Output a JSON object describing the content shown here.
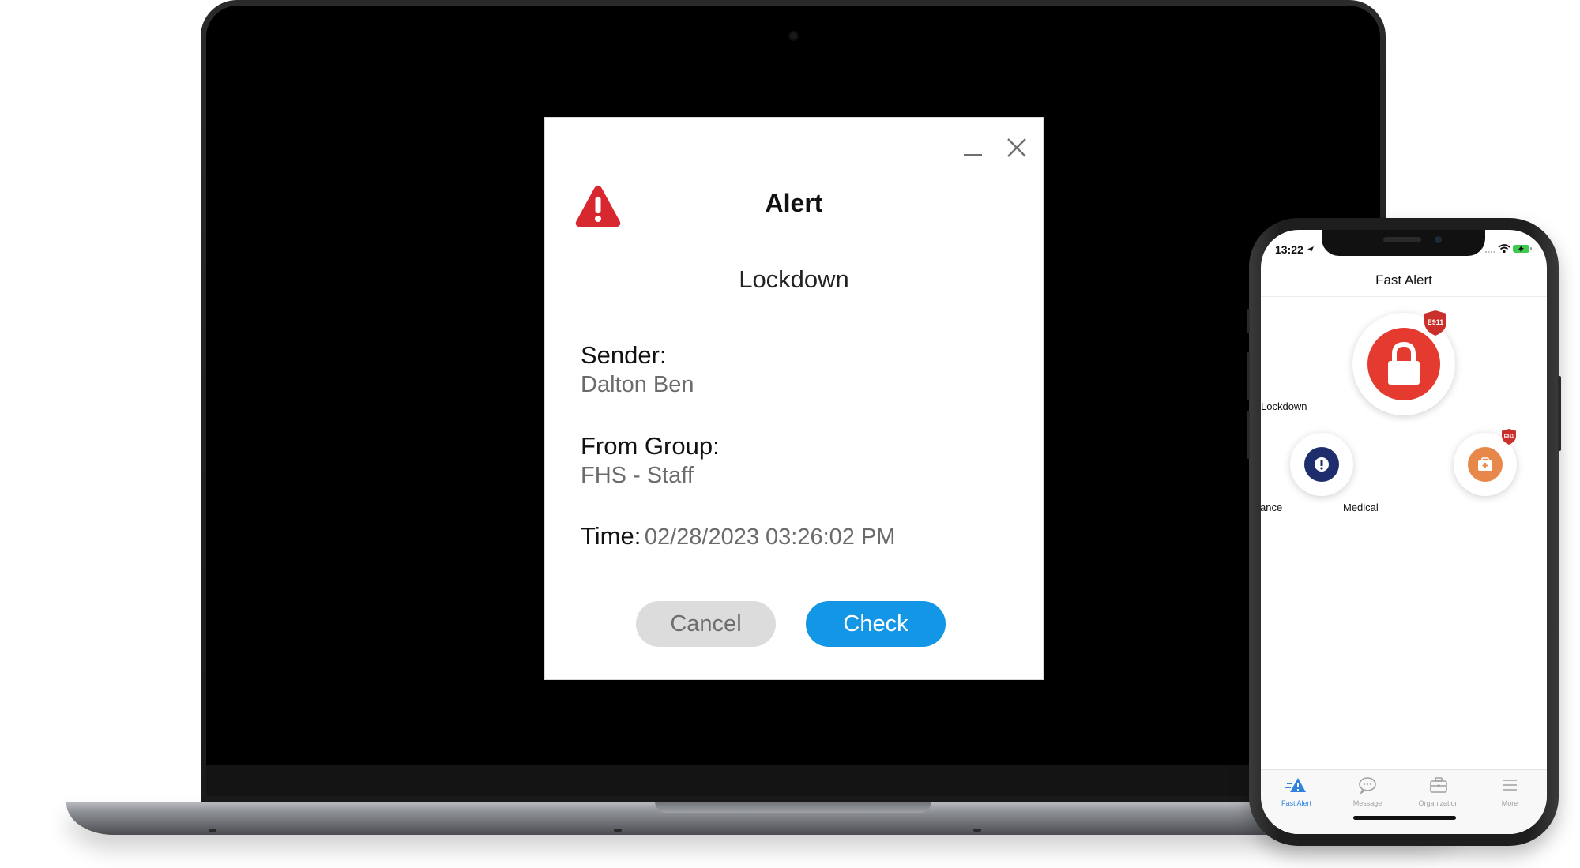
{
  "dialog": {
    "title": "Alert",
    "alert_type": "Lockdown",
    "sender_label": "Sender:",
    "sender_value": "Dalton Ben",
    "group_label": "From Group:",
    "group_value": "FHS - Staff",
    "time_label": "Time:",
    "time_value": "02/28/2023 03:26:02 PM",
    "cancel_label": "Cancel",
    "check_label": "Check",
    "icons": [
      "warning-triangle-icon",
      "minimize-icon",
      "close-icon"
    ]
  },
  "phone": {
    "status_time": "13:22",
    "app_title": "Fast Alert",
    "actions": [
      {
        "label": "Lockdown",
        "icon": "lock-icon",
        "color": "#e53a2f",
        "badge": "E911"
      },
      {
        "label": "Staff Assistance",
        "icon": "exclamation-icon",
        "color": "#1e2d6b"
      },
      {
        "label": "Medical",
        "icon": "first-aid-icon",
        "color": "#e8874a",
        "badge": "E911"
      }
    ],
    "tabs": [
      {
        "label": "Fast Alert",
        "active": true
      },
      {
        "label": "Message",
        "active": false
      },
      {
        "label": "Organization",
        "active": false
      },
      {
        "label": "More",
        "active": false
      }
    ]
  },
  "colors": {
    "alert_red": "#d7282f",
    "check_blue": "#1496e6",
    "tab_active": "#2f82e0"
  }
}
